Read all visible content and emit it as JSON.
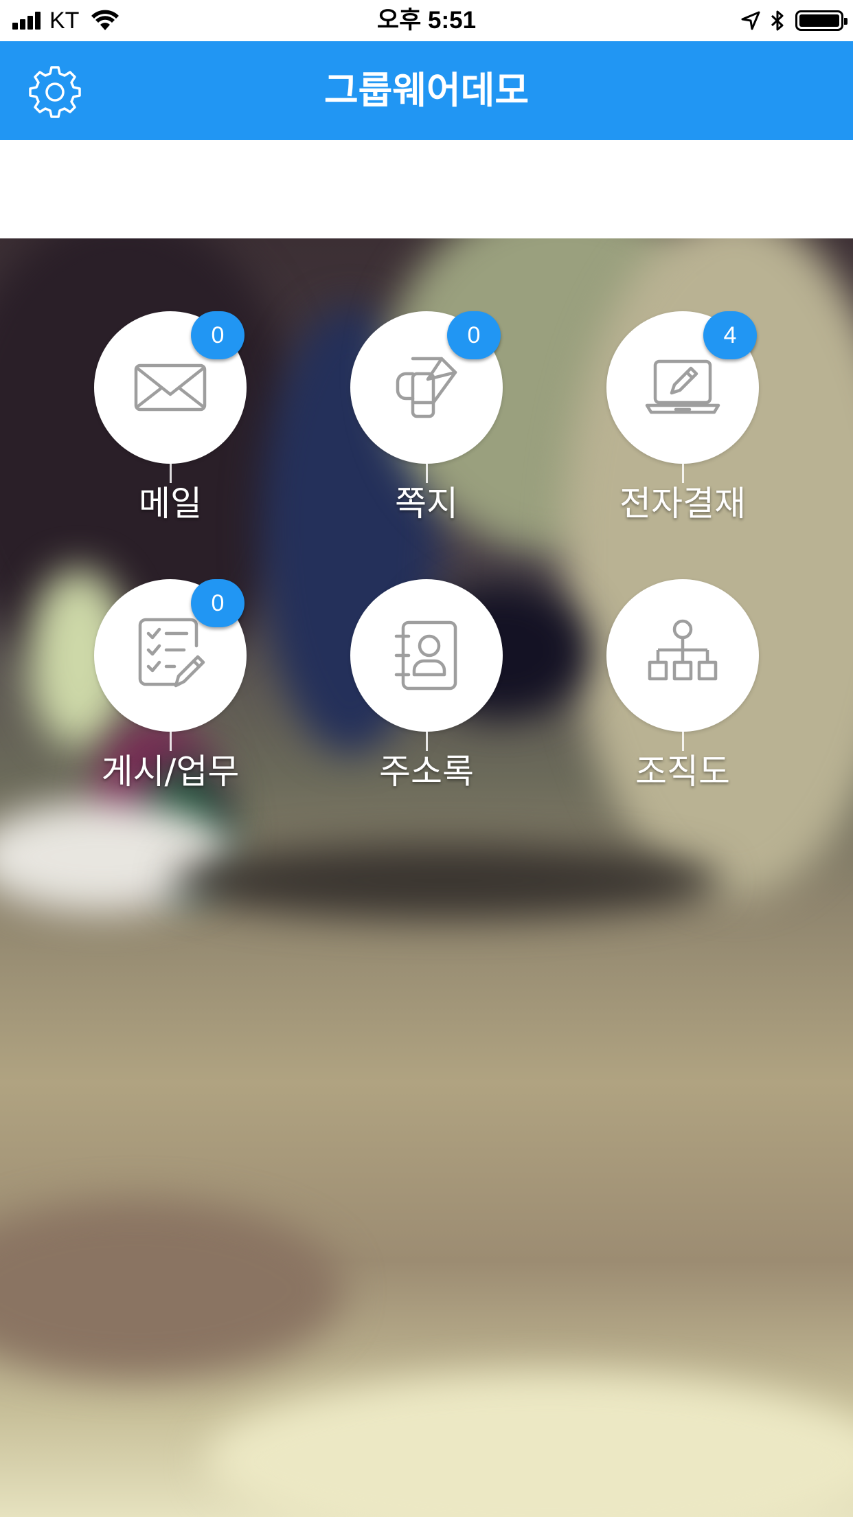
{
  "status_bar": {
    "carrier": "KT",
    "time": "오후 5:51"
  },
  "header": {
    "title": "그룹웨어데모",
    "settings_icon": "gear-icon",
    "color": "#2196f3"
  },
  "menu": [
    {
      "label": "메일",
      "icon": "mail-icon",
      "badge": "0"
    },
    {
      "label": "쪽지",
      "icon": "note-icon",
      "badge": "0"
    },
    {
      "label": "전자결재",
      "icon": "laptop-pencil-icon",
      "badge": "4"
    },
    {
      "label": "게시/업무",
      "icon": "checklist-icon",
      "badge": "0"
    },
    {
      "label": "주소록",
      "icon": "address-book-icon"
    },
    {
      "label": "조직도",
      "icon": "org-chart-icon"
    }
  ]
}
